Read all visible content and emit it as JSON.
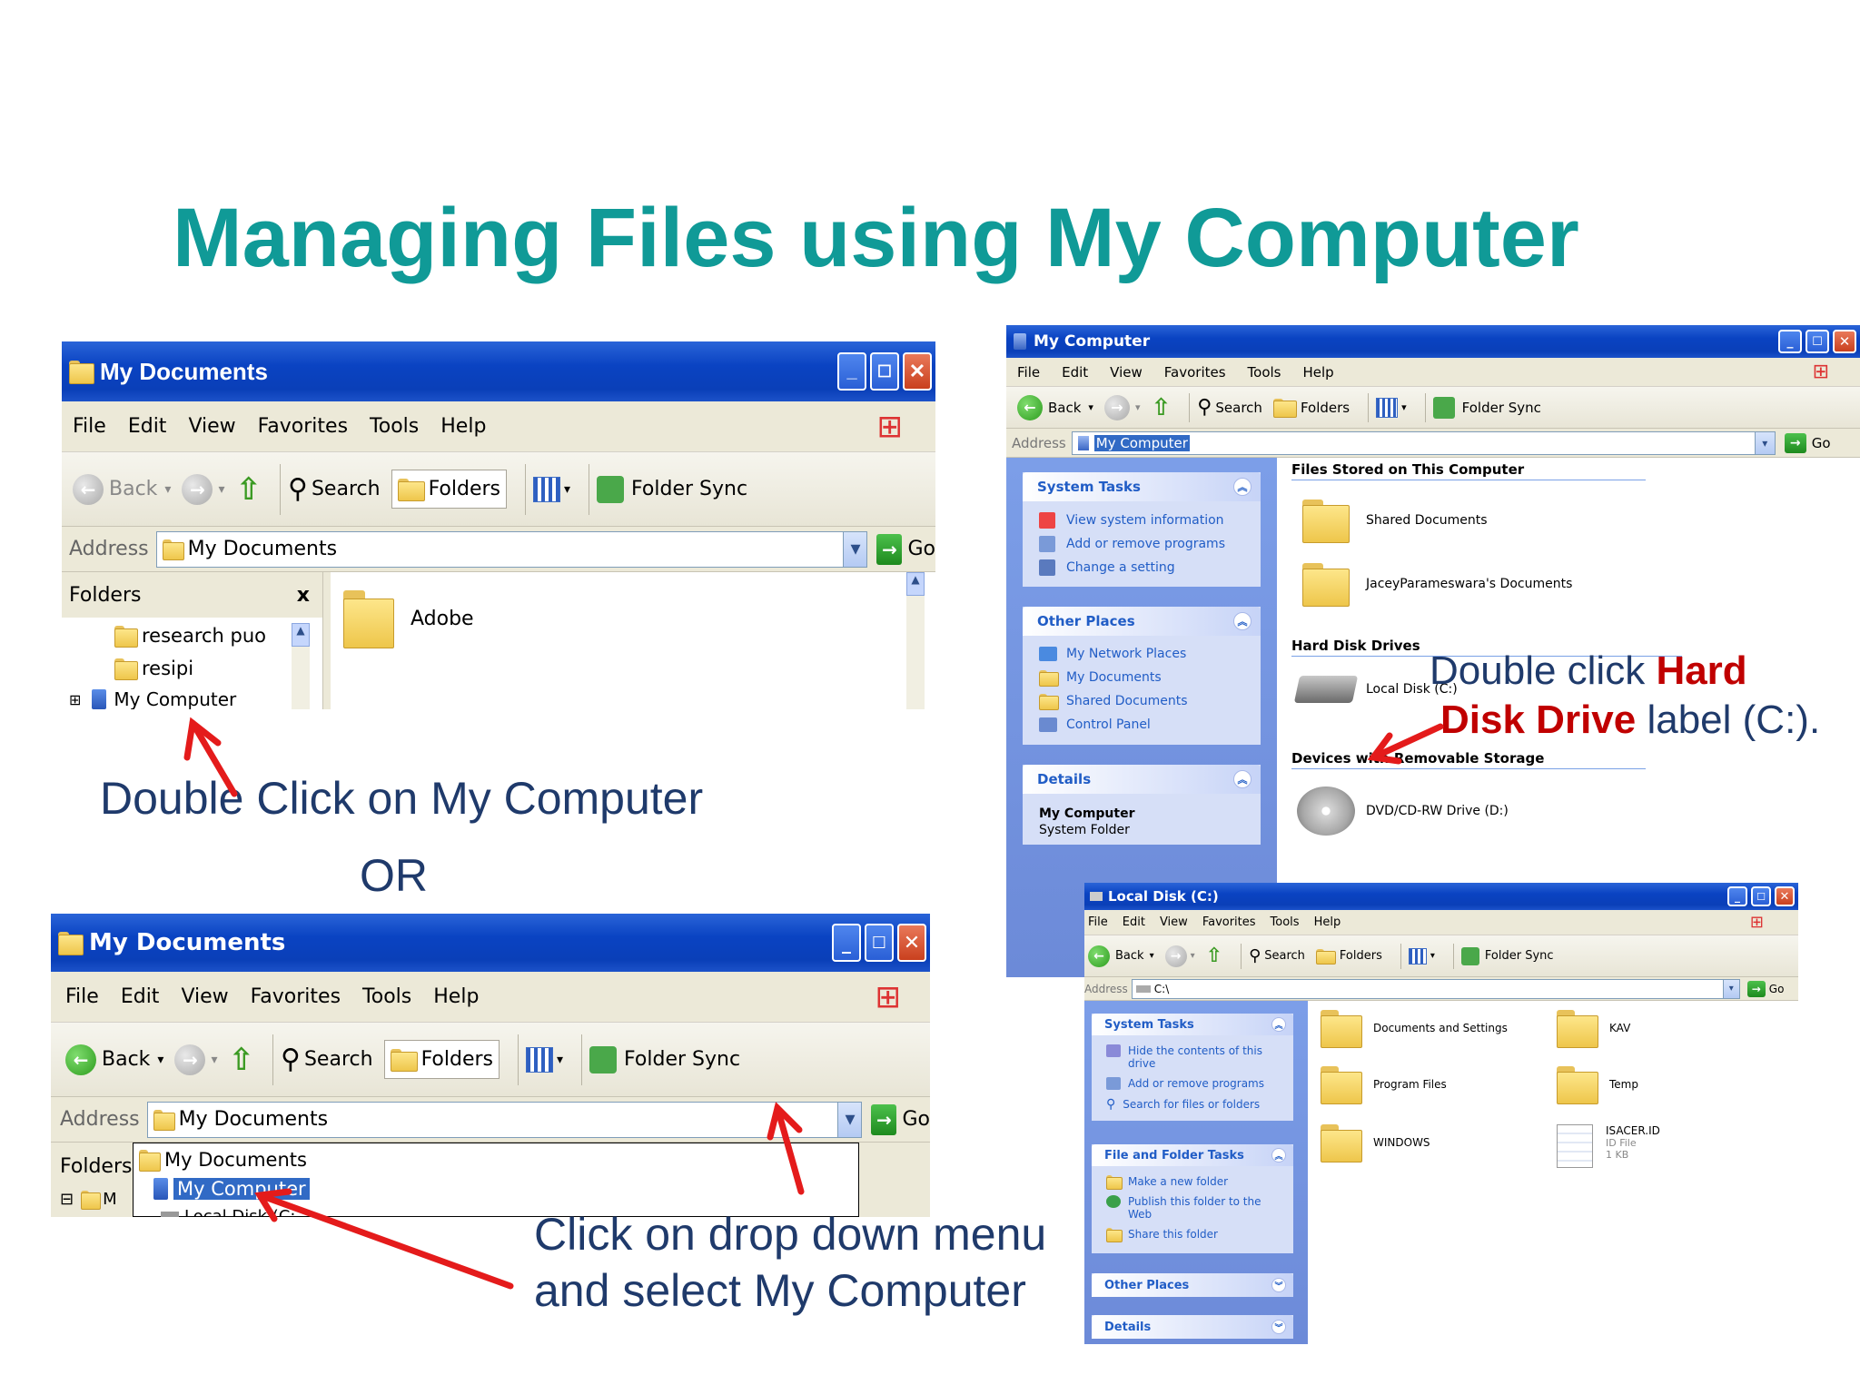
{
  "slide": {
    "title": "Managing Files using My Computer",
    "caption_double_click": "Double Click on My Computer",
    "caption_or": "OR",
    "caption_dropdown_line1": "Click on drop down menu",
    "caption_dropdown_line2": "and select My Computer",
    "caption_hdd_line1_pre": "Double click ",
    "caption_hdd_line1_hl": "Hard",
    "caption_hdd_line2_hl": "Disk Drive",
    "caption_hdd_line2_post": " label (C:)."
  },
  "win1": {
    "title": "My Documents",
    "menu": [
      "File",
      "Edit",
      "View",
      "Favorites",
      "Tools",
      "Help"
    ],
    "back": "Back",
    "search": "Search",
    "folders": "Folders",
    "folder_sync": "Folder Sync",
    "address_label": "Address",
    "address_value": "My Documents",
    "go": "Go",
    "folders_pane_title": "Folders",
    "folders_close": "x",
    "tree": [
      "research puo",
      "resipi",
      "My Computer"
    ],
    "tree_expander": "⊞",
    "content_item": "Adobe"
  },
  "win2": {
    "title": "My Documents",
    "menu": [
      "File",
      "Edit",
      "View",
      "Favorites",
      "Tools",
      "Help"
    ],
    "back": "Back",
    "search": "Search",
    "folders": "Folders",
    "folder_sync": "Folder Sync",
    "address_label": "Address",
    "address_value": "My Documents",
    "go": "Go",
    "folders_pane_title": "Folders",
    "dropdown_items": [
      "My Documents",
      "My Computer",
      "Local Disk (C:"
    ],
    "tree_expander": "⊟",
    "tree_partial": "M"
  },
  "win3": {
    "title": "My Computer",
    "menu": [
      "File",
      "Edit",
      "View",
      "Favorites",
      "Tools",
      "Help"
    ],
    "back": "Back",
    "search": "Search",
    "folders": "Folders",
    "folder_sync": "Folder Sync",
    "address_label": "Address",
    "address_value": "My Computer",
    "go": "Go",
    "system_tasks": {
      "title": "System Tasks",
      "items": [
        "View system information",
        "Add or remove programs",
        "Change a setting"
      ]
    },
    "other_places": {
      "title": "Other Places",
      "items": [
        "My Network Places",
        "My Documents",
        "Shared Documents",
        "Control Panel"
      ]
    },
    "details": {
      "title": "Details",
      "name": "My Computer",
      "desc": "System Folder"
    },
    "sections": {
      "files_stored": "Files Stored on This Computer",
      "hard_disk": "Hard Disk Drives",
      "removable": "Devices with Removable Storage"
    },
    "files": [
      "Shared Documents",
      "JaceyParameswara's Documents"
    ],
    "local_disk": "Local Disk (C:)",
    "dvd": "DVD/CD-RW Drive (D:)"
  },
  "win4": {
    "title": "Local Disk (C:)",
    "menu": [
      "File",
      "Edit",
      "View",
      "Favorites",
      "Tools",
      "Help"
    ],
    "back": "Back",
    "search": "Search",
    "folders": "Folders",
    "folder_sync": "Folder Sync",
    "address_label": "Address",
    "address_value": "C:\\",
    "go": "Go",
    "system_tasks": {
      "title": "System Tasks",
      "items": [
        "Hide the contents of this drive",
        "Add or remove programs",
        "Search for files or folders"
      ]
    },
    "file_folder_tasks": {
      "title": "File and Folder Tasks",
      "items": [
        "Make a new folder",
        "Publish this folder to the Web",
        "Share this folder"
      ]
    },
    "other_places": "Other Places",
    "details": "Details",
    "folders_left": [
      "Documents and Settings",
      "Program Files",
      "WINDOWS"
    ],
    "folders_right": [
      "KAV",
      "Temp"
    ],
    "file": {
      "name": "ISACER.ID",
      "type": "ID File",
      "size": "1 KB"
    }
  },
  "colors": {
    "title_teal": "#109a97",
    "caption_navy": "#1f3a6b",
    "highlight_red": "#c00000",
    "arrow_red": "#e41b1b",
    "xp_blue": "#0a43c2"
  }
}
